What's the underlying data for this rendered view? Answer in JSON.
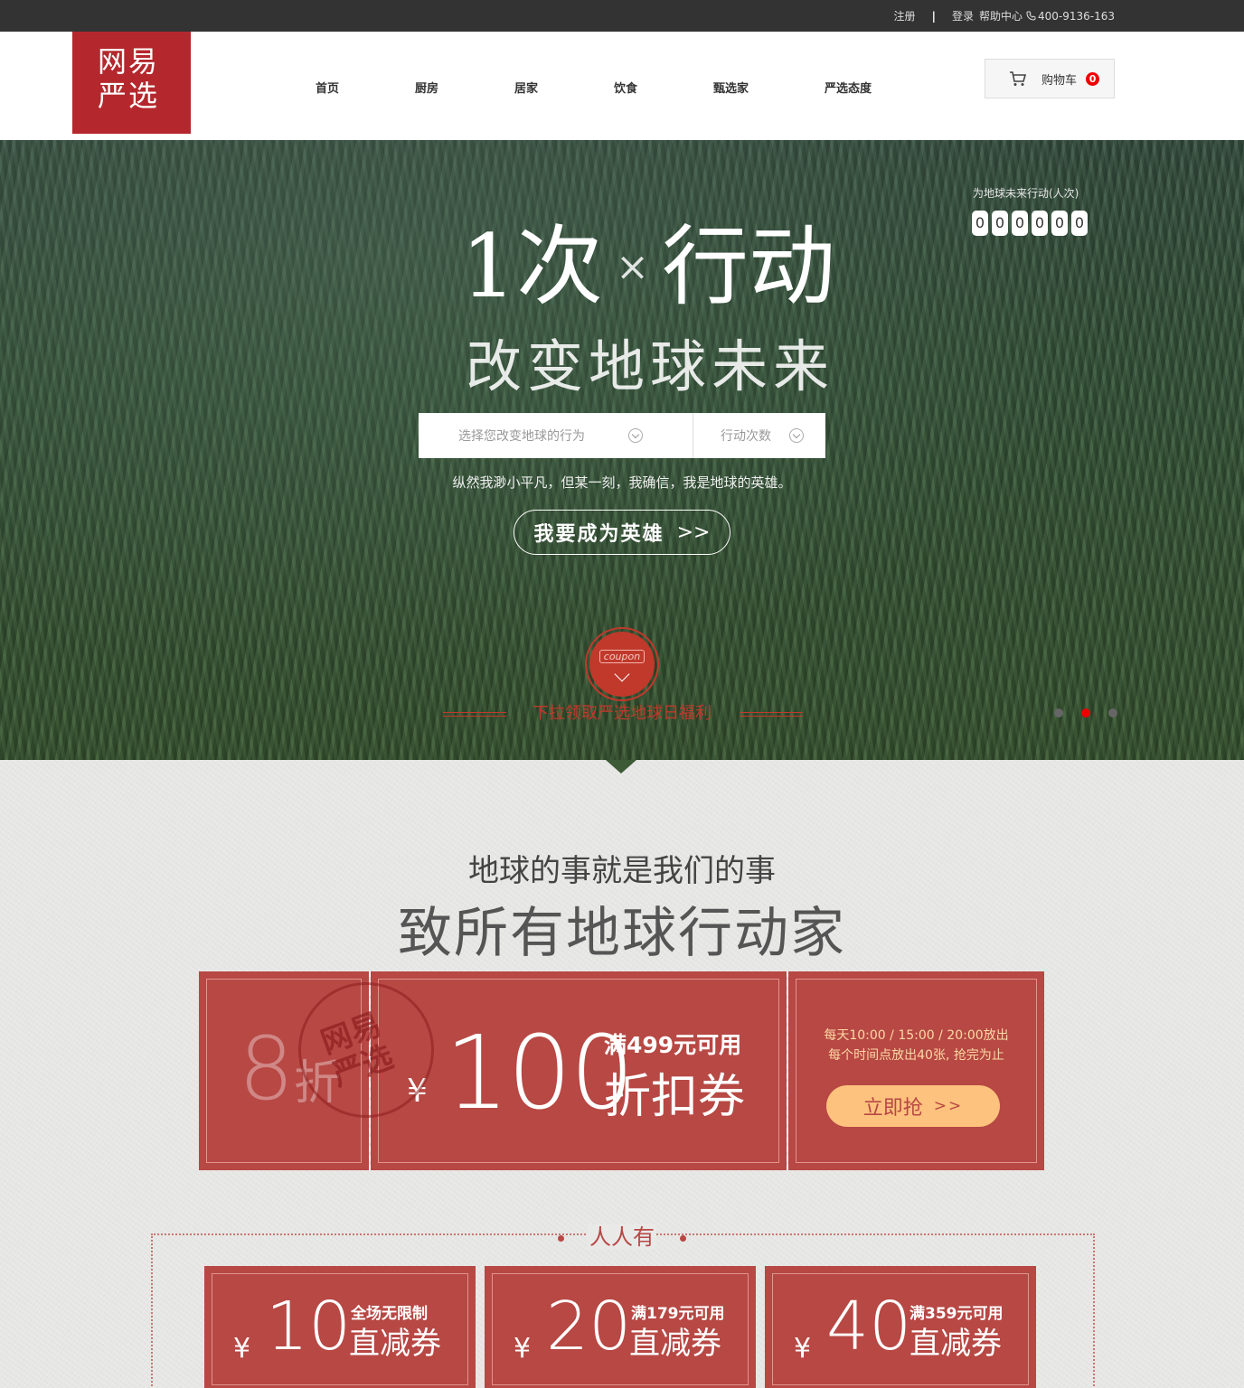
{
  "topbar": {
    "register": "注册",
    "separator": "|",
    "login": "登录",
    "help": "帮助中心",
    "phone": "400-9136-163"
  },
  "header": {
    "logo_line1": "网易",
    "logo_line2": "严选",
    "nav": [
      "首页",
      "厨房",
      "居家",
      "饮食",
      "甄选家",
      "严选态度"
    ],
    "cart_label": "购物车",
    "cart_count": "0"
  },
  "hero": {
    "title_prefix": "1次",
    "title_x": "×",
    "title_suffix": "行动",
    "subtitle": "改变地球未来",
    "counter_label": "为地球未来行动(人次)",
    "counter_digits": [
      "0",
      "0",
      "0",
      "0",
      "0",
      "0"
    ],
    "select_action_placeholder": "选择您改变地球的行为",
    "select_count_placeholder": "行动次数",
    "tagline": "纵然我渺小平凡，但某一刻，我确信，我是地球的英雄。",
    "cta": "我要成为英雄",
    "cta_arrow": ">>",
    "coupon_tag": "coupon",
    "coupon_text": "下拉领取严选地球日福利",
    "slider_dots": 3,
    "slider_active": 1
  },
  "offer": {
    "heading1": "地球的事就是我们的事",
    "heading2": "致所有地球行动家",
    "discount_num": "8",
    "discount_unit": "折",
    "stamp_text": "网易严选",
    "stamp_line1": "网易",
    "stamp_line2": "严选",
    "main_coupon": {
      "currency": "¥",
      "amount": "100",
      "condition": "满499元可用",
      "kind": "折扣券"
    },
    "schedule_line1": "每天10:00 / 15:00 / 20:00放出",
    "schedule_line2": "每个时间点放出40张, 抢完为止",
    "grab_label": "立即抢",
    "grab_arrow": ">>"
  },
  "everyone": {
    "title": "人人有",
    "coupons": [
      {
        "currency": "¥",
        "amount": "10",
        "condition": "全场无限制",
        "kind": "直减券"
      },
      {
        "currency": "¥",
        "amount": "20",
        "condition": "满179元可用",
        "kind": "直减券"
      },
      {
        "currency": "¥",
        "amount": "40",
        "condition": "满359元可用",
        "kind": "直减券"
      }
    ]
  },
  "colors": {
    "brand_red": "#b4282d",
    "ticket_red": "#b74844",
    "grab_button": "#fdc27d",
    "topbar": "#333333"
  }
}
